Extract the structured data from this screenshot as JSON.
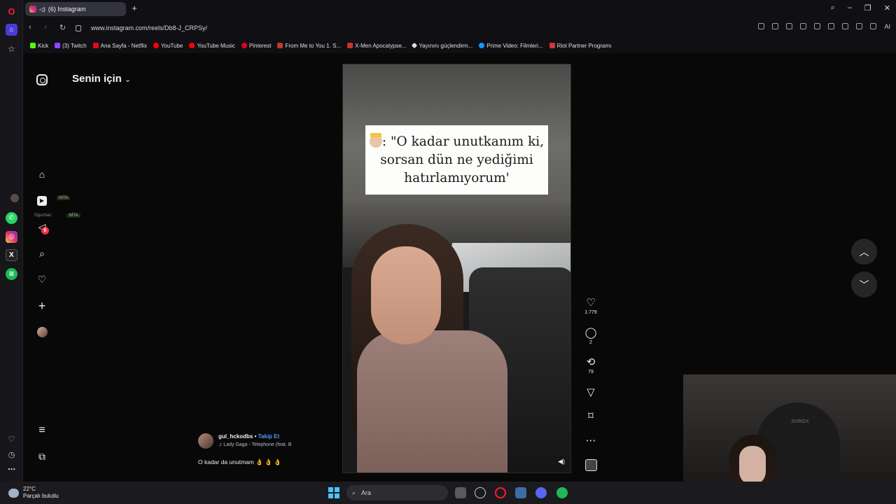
{
  "browser": {
    "tab_title": "(6) Instagram",
    "url": "www.instagram.com/reels/Db8-J_CRPSy/",
    "ai_label": "AI",
    "bookmarks": [
      {
        "label": "Kick",
        "color": "#53fc18"
      },
      {
        "label": "(3) Twitch",
        "color": "#9146ff"
      },
      {
        "label": "Ana Sayfa - Netflix",
        "color": "#e50914"
      },
      {
        "label": "YouTube",
        "color": "#ff0000"
      },
      {
        "label": "YouTube Music",
        "color": "#ff0000"
      },
      {
        "label": "Pinterest",
        "color": "#e60023"
      },
      {
        "label": "From Me to You 1. S...",
        "color": "#c0392b"
      },
      {
        "label": "X-Men Apocalypse...",
        "color": "#c0392b"
      },
      {
        "label": "Yayınını güçlendirm...",
        "color": "#dddddd"
      },
      {
        "label": "Prime Video: Filmleri...",
        "color": "#1399ff"
      },
      {
        "label": "Riot Partner Programı",
        "color": "#d13639"
      }
    ]
  },
  "sidebar": {
    "feed_title": "Senin için",
    "messages_badge": "6",
    "ghost_tag": "NİTA",
    "ghost_name": "Oguzhan"
  },
  "reel": {
    "overlay_text": ": \"O kadar unutkanım ki, sorsan dün ne yediğimi hatırlamıyorum'",
    "likes": "1.779",
    "comments": "2",
    "reposts": "79",
    "author": "gul_hckodbs",
    "separator": "•",
    "follow_label": "Takip Et",
    "song": "Lady Gaga - Telephone (feat. B",
    "caption": "O kadar da unutmam 👌 👌 👌"
  },
  "webcam": {
    "chair_brand": "3VIRGX"
  },
  "taskbar": {
    "temperature": "22°C",
    "weather": "Parçalı bulutlu",
    "search_placeholder": "Ara"
  },
  "colors": {
    "accent_follow": "#4d9cff",
    "badge": "#ff3040",
    "opera_red": "#ff1b2d"
  }
}
